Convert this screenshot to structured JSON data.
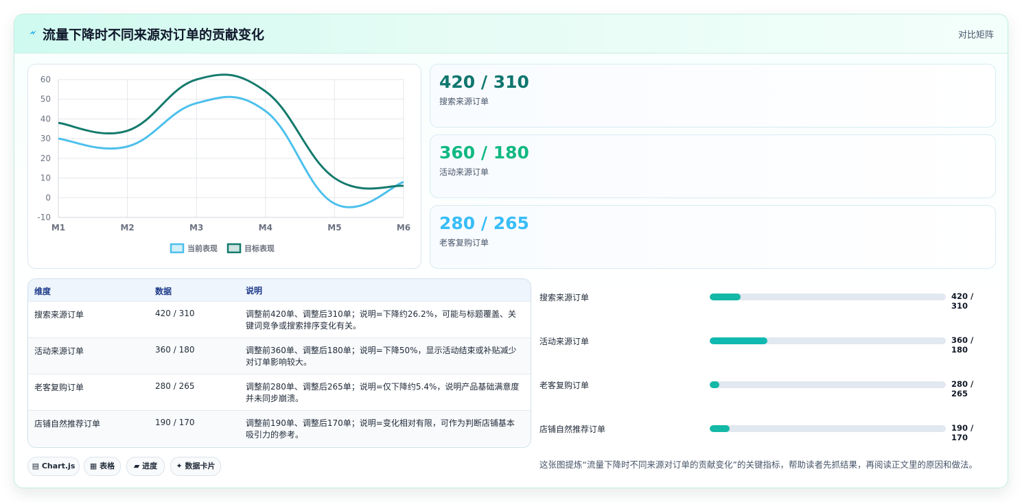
{
  "header": {
    "title": "流量下降时不同来源对订单的贡献变化",
    "tag": "对比矩阵"
  },
  "chart_data": {
    "type": "line",
    "categories": [
      "M1",
      "M2",
      "M3",
      "M4",
      "M5",
      "M6"
    ],
    "series": [
      {
        "name": "当前表现",
        "color": "#4cc0ec",
        "values": [
          30,
          26,
          48,
          44,
          -3,
          8
        ]
      },
      {
        "name": "目标表现",
        "color": "#147a6c",
        "values": [
          38,
          34,
          60,
          54,
          10,
          6
        ]
      }
    ],
    "ylim": [
      -10,
      60
    ],
    "yticks": [
      60,
      50,
      40,
      30,
      20,
      10,
      0,
      -10
    ],
    "grid": true,
    "legend": "bottom"
  },
  "kpis": [
    {
      "value": "420 / 310",
      "label": "搜索来源订单",
      "color": "#0f766e"
    },
    {
      "value": "360 / 180",
      "label": "活动来源订单",
      "color": "#10b981"
    },
    {
      "value": "280 / 265",
      "label": "老客复购订单",
      "color": "#38bdf8"
    }
  ],
  "table": {
    "headers": [
      "维度",
      "数据",
      "说明"
    ],
    "rows": [
      {
        "dim": "搜索来源订单",
        "data": "420 / 310",
        "desc": "调整前420单、调整后310单；说明=下降约26.2%，可能与标题覆盖、关键词竞争或搜索排序变化有关。"
      },
      {
        "dim": "活动来源订单",
        "data": "360 / 180",
        "desc": "调整前360单、调整后180单；说明=下降50%，显示活动结束或补贴减少对订单影响较大。"
      },
      {
        "dim": "老客复购订单",
        "data": "280 / 265",
        "desc": "调整前280单、调整后265单；说明=仅下降约5.4%，说明产品基础满意度并未同步崩溃。"
      },
      {
        "dim": "店铺自然推荐订单",
        "data": "190 / 170",
        "desc": "调整前190单、调整后170单；说明=变化相对有限，可作为判断店铺基本吸引力的参考。"
      }
    ]
  },
  "chips": [
    {
      "icon": "▤",
      "label": "Chart.js"
    },
    {
      "icon": "▦",
      "label": "表格"
    },
    {
      "icon": "▰",
      "label": "进度"
    },
    {
      "icon": "✦",
      "label": "数据卡片"
    }
  ],
  "progress": [
    {
      "name": "搜索来源订单",
      "value": "420 / 310",
      "fill": 0.13,
      "color": "#14b8a6"
    },
    {
      "name": "活动来源订单",
      "value": "360 / 180",
      "fill": 0.245,
      "color": "#10b9b0"
    },
    {
      "name": "老客复购订单",
      "value": "280 / 265",
      "fill": 0.04,
      "color": "#14b8a6"
    },
    {
      "name": "店铺自然推荐订单",
      "value": "190 / 170",
      "fill": 0.085,
      "color": "#14b8a6"
    }
  ],
  "note": "这张图提炼“流量下降时不同来源对订单的贡献变化”的关键指标，帮助读者先抓结果，再阅读正文里的原因和做法。"
}
